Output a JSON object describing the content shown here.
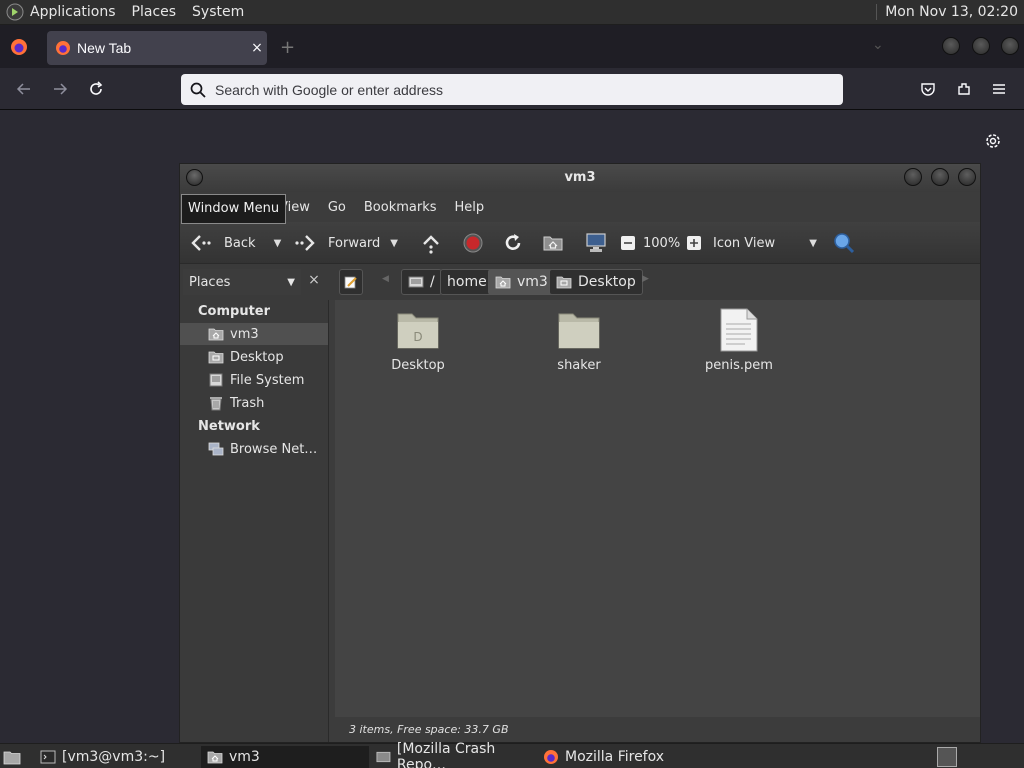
{
  "top_panel": {
    "menus": [
      "Applications",
      "Places",
      "System"
    ],
    "clock": "Mon Nov 13, 02:20"
  },
  "firefox": {
    "tab_title": "New Tab",
    "tab_close": "×",
    "new_tab": "+",
    "url_placeholder": "Search with Google or enter address"
  },
  "caja": {
    "window_title": "vm3",
    "tooltip": "Window Menu",
    "menu": {
      "view": "View",
      "go": "Go",
      "bookmarks": "Bookmarks",
      "help": "Help"
    },
    "toolbar": {
      "back": "Back",
      "forward": "Forward",
      "zoom": "100%",
      "view_mode": "Icon View"
    },
    "location": {
      "places_combo": "Places",
      "close": "×",
      "crumbs": [
        "/",
        "home",
        "vm3",
        "Desktop"
      ]
    },
    "sidebar": {
      "sections": [
        {
          "heading": "Computer",
          "items": [
            {
              "label": "vm3",
              "icon": "home-folder-icon"
            },
            {
              "label": "Desktop",
              "icon": "desktop-folder-icon"
            },
            {
              "label": "File System",
              "icon": "drive-icon"
            },
            {
              "label": "Trash",
              "icon": "trash-icon"
            }
          ]
        },
        {
          "heading": "Network",
          "items": [
            {
              "label": "Browse Net…",
              "icon": "network-icon"
            }
          ]
        }
      ]
    },
    "files": [
      {
        "name": "Desktop",
        "icon": "desktop-folder-icon"
      },
      {
        "name": "shaker",
        "icon": "folder-icon"
      },
      {
        "name": "penis.pem",
        "icon": "text-file-icon"
      }
    ],
    "status": "3 items, Free space: 33.7 GB"
  },
  "taskbar": {
    "tasks": [
      "[vm3@vm3:~]",
      "vm3",
      "[Mozilla Crash Repo…",
      "Mozilla Firefox"
    ]
  }
}
